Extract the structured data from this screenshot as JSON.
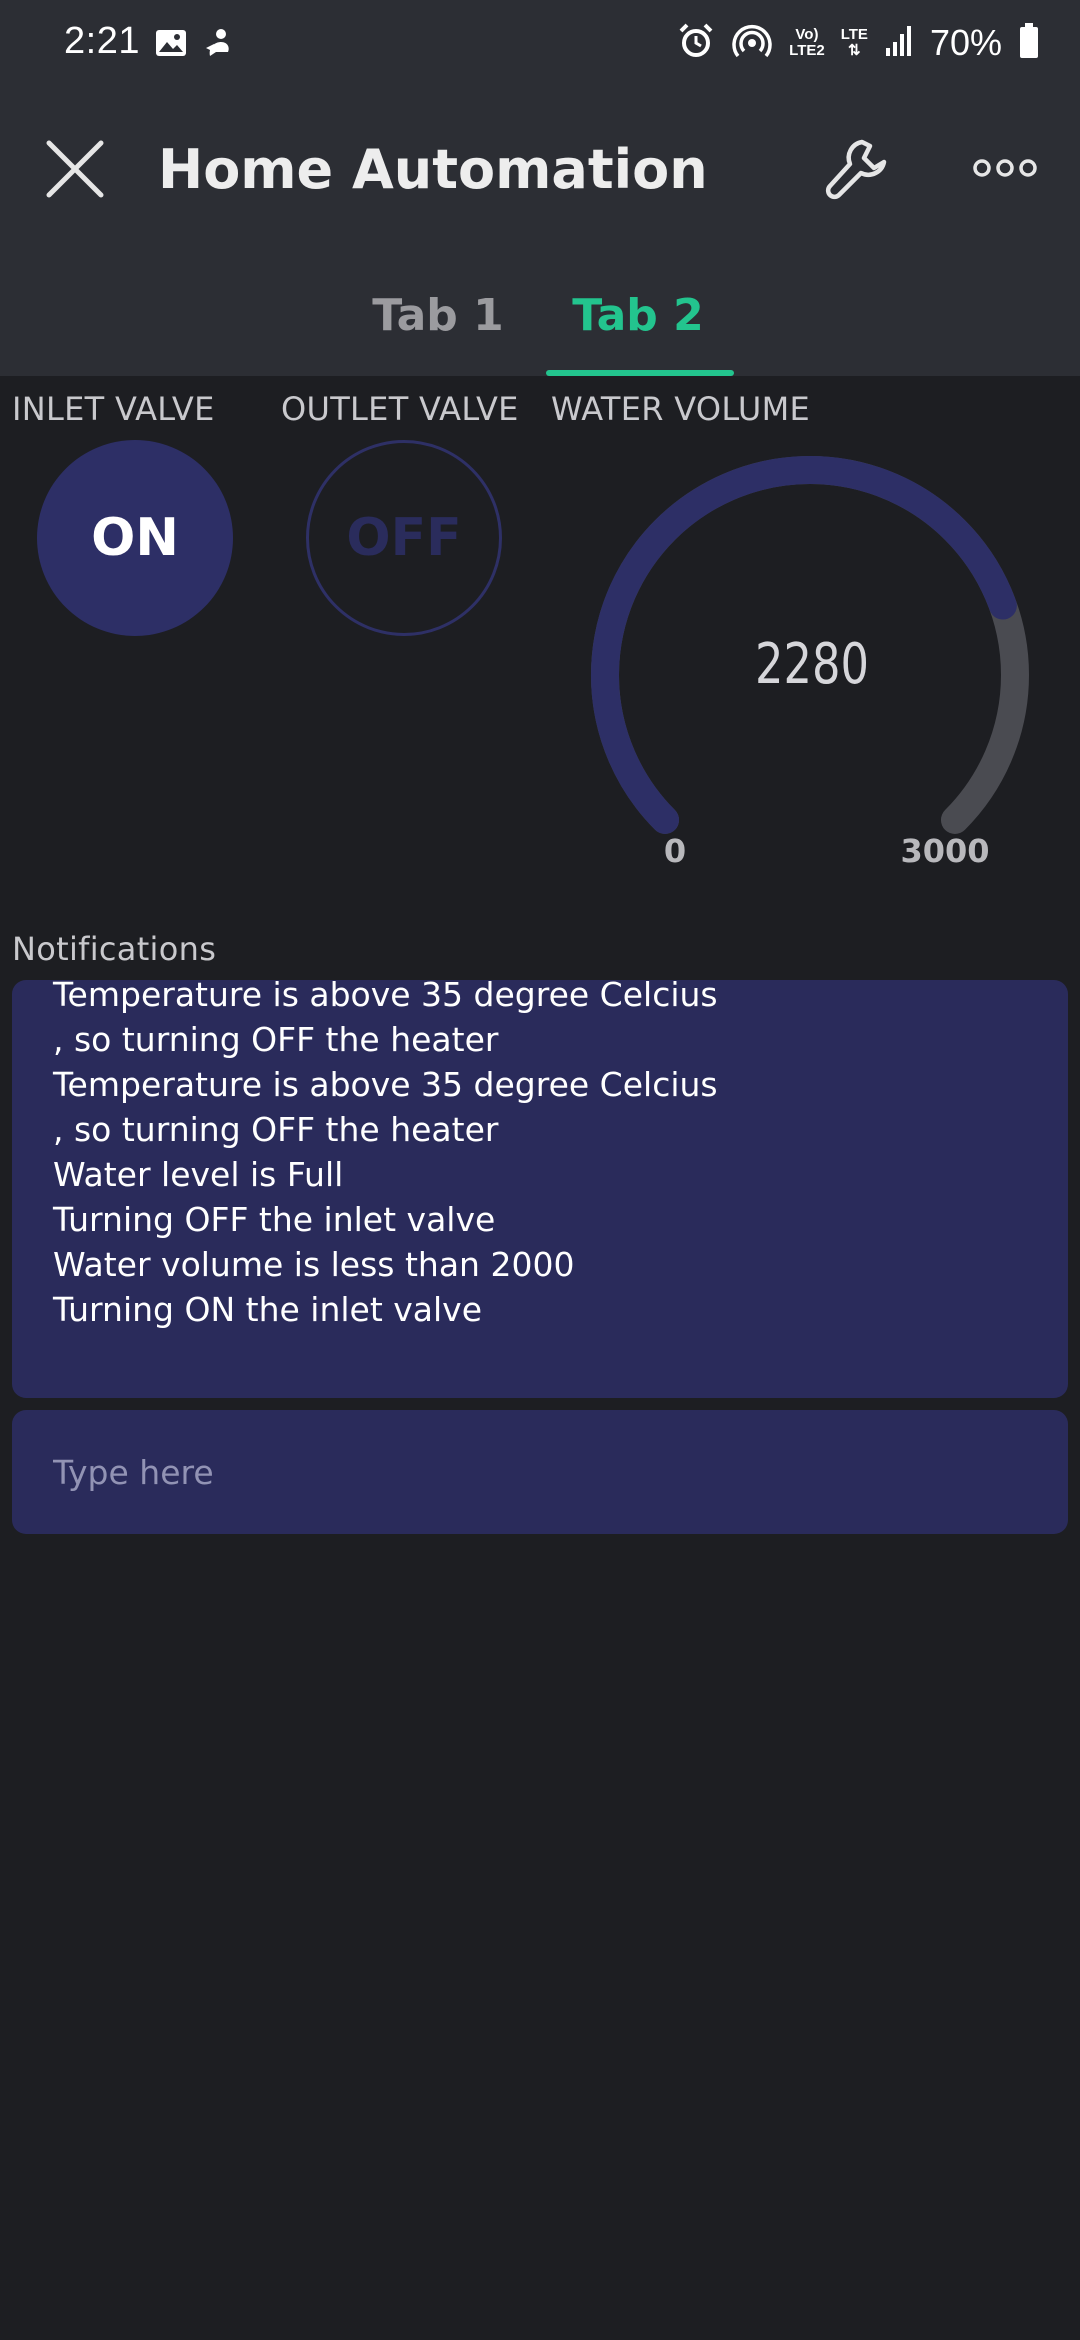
{
  "status_bar": {
    "time": "2:21",
    "battery": "70%",
    "net_top": "Vo)",
    "net_bottom": "LTE2",
    "lte_label": "LTE"
  },
  "app_bar": {
    "title": "Home Automation"
  },
  "tabs": [
    {
      "label": "Tab 1",
      "active": false
    },
    {
      "label": "Tab 2",
      "active": true
    }
  ],
  "widgets": {
    "inlet_valve": {
      "label": "INLET VALVE",
      "state": "ON"
    },
    "outlet_valve": {
      "label": "OUTLET VALVE",
      "state": "OFF"
    },
    "water_volume": {
      "label": "WATER VOLUME",
      "value": "2280",
      "min": "0",
      "max": "3000",
      "fill_fraction": 0.76
    }
  },
  "notifications": {
    "label": "Notifications",
    "lines": [
      "Temperature is above 35 degree Celcius",
      ", so turning OFF the heater",
      "Temperature is above 35 degree Celcius",
      ", so turning OFF the heater",
      "Water level is Full",
      "Turning OFF the inlet valve",
      "Water volume is less than 2000",
      "Turning ON the inlet valve"
    ],
    "input_placeholder": "Type here"
  },
  "colors": {
    "accent": "#23c48e",
    "widget_bg": "#2a2b5b",
    "gauge_fill": "#2d2f66",
    "gauge_track": "#4a4b51"
  }
}
